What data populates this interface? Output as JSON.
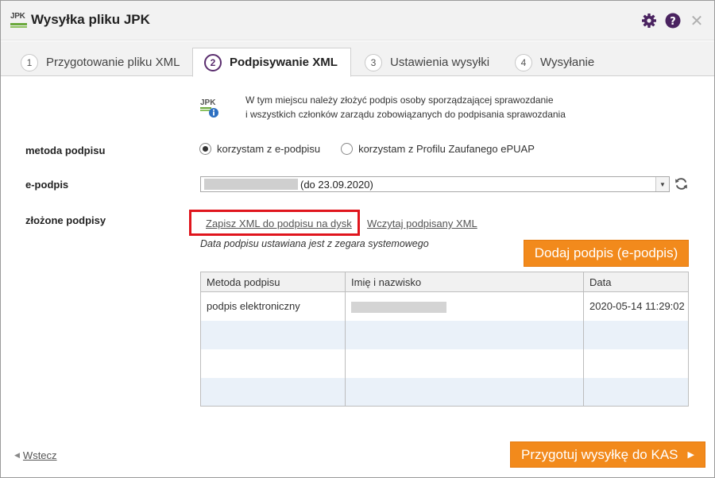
{
  "window": {
    "title": "Wysyłka pliku JPK",
    "logo_text": "JPK"
  },
  "tabs": [
    {
      "num": "1",
      "label": "Przygotowanie pliku XML",
      "active": false
    },
    {
      "num": "2",
      "label": "Podpisywanie XML",
      "active": true
    },
    {
      "num": "3",
      "label": "Ustawienia wysyłki",
      "active": false
    },
    {
      "num": "4",
      "label": "Wysyłanie",
      "active": false
    }
  ],
  "info": {
    "line1": "W tym miejscu należy złożyć podpis osoby sporządzającej sprawozdanie",
    "line2": "i wszystkich członków zarządu zobowiązanych do podpisania sprawozdania"
  },
  "method": {
    "label": "metoda podpisu",
    "options": [
      "korzystam z e-podpisu",
      "korzystam z Profilu Zaufanego ePUAP"
    ],
    "selected_index": 0
  },
  "esign": {
    "label": "e-podpis",
    "value": "(do 23.09.2020)"
  },
  "signatures": {
    "label": "złożone podpisy",
    "save_link": "Zapisz XML do podpisu na dysk",
    "load_link": "Wczytaj podpisany XML",
    "note": "Data podpisu ustawiana jest z zegara systemowego",
    "add_button": "Dodaj podpis (e-podpis)",
    "columns": [
      "Metoda podpisu",
      "Imię i nazwisko",
      "Data"
    ],
    "rows": [
      {
        "method": "podpis elektroniczny",
        "date": "2020-05-14 11:29:02"
      }
    ]
  },
  "footer": {
    "back": "Wstecz",
    "prepare": "Przygotuj wysyłkę do KAS"
  },
  "colors": {
    "accent_orange": "#f28a1c",
    "brand_purple": "#5a2d6e",
    "highlight_red": "#e0151d",
    "logo_green": "#6aa83b"
  }
}
